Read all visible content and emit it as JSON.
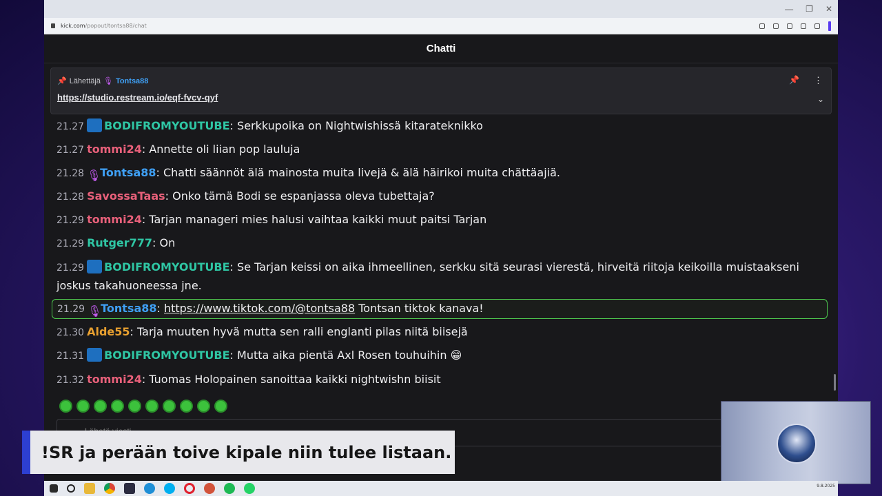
{
  "browser": {
    "url_prefix": "kick.com",
    "url_path": "/popout/tontsa88/chat"
  },
  "chat": {
    "title": "Chatti",
    "pinned": {
      "sender_label": "Lähettäjä",
      "sender_name": "Tontsa88",
      "link": "https://studio.restream.io/eqf-fvcv-qyf"
    },
    "messages": [
      {
        "time": "21.27",
        "user": "BODIFROMYOUTUBE",
        "user_color": "#2fc6a4",
        "badge": "mod",
        "text": "Serkkupoika on Nightwishissä kitarateknikko"
      },
      {
        "time": "21.27",
        "user": "tommi24",
        "user_color": "#e8607a",
        "badge": "",
        "text": "Annette oli liian pop lauluja"
      },
      {
        "time": "21.28",
        "user": "Tontsa88",
        "user_color": "#3fa0f5",
        "badge": "mic",
        "text": "Chatti säännöt älä mainosta muita livejä & älä häirikoi muita chättäajiä."
      },
      {
        "time": "21.28",
        "user": "SavossaTaas",
        "user_color": "#e8607a",
        "badge": "",
        "text": "Onko tämä Bodi se espanjassa oleva tubettaja?"
      },
      {
        "time": "21.29",
        "user": "tommi24",
        "user_color": "#e8607a",
        "badge": "",
        "text": "Tarjan manageri mies halusi vaihtaa kaikki muut paitsi Tarjan"
      },
      {
        "time": "21.29",
        "user": "Rutger777",
        "user_color": "#2fc6a4",
        "badge": "",
        "text": "On"
      },
      {
        "time": "21.29",
        "user": "BODIFROMYOUTUBE",
        "user_color": "#2fc6a4",
        "badge": "mod",
        "text": "Se Tarjan keissi on aika ihmeellinen, serkku sitä seurasi vierestä, hirveitä riitoja keikoilla muistaakseni joskus takahuoneessa jne."
      },
      {
        "time": "21.29",
        "user": "Tontsa88",
        "user_color": "#3fa0f5",
        "badge": "mic",
        "link": "https://www.tiktok.com/@tontsa88",
        "text": "Tontsan tiktok kanava!"
      },
      {
        "time": "21.30",
        "user": "Alde55",
        "user_color": "#e8a030",
        "badge": "",
        "text": "Tarja muuten hyvä mutta sen ralli englanti pilas niitä biisejä"
      },
      {
        "time": "21.31",
        "user": "BODIFROMYOUTUBE",
        "user_color": "#2fc6a4",
        "badge": "mod",
        "text": "Mutta aika pientä Axl Rosen touhuihin 😁"
      },
      {
        "time": "21.32",
        "user": "tommi24",
        "user_color": "#e8607a",
        "badge": "",
        "text": "Tuomas Holopainen sanoittaa kaikki nightwishn biisit"
      }
    ],
    "input_placeholder": "Lähetä viesti"
  },
  "overlay": {
    "banner_text": "!SR ja perään toive kipale niin tulee listaan."
  },
  "taskbar": {
    "clock_date": "9.8.2025"
  },
  "colors": {
    "accent_green": "#4ec94e",
    "mod_badge": "#1e6fbf",
    "banner_accent": "#2d3fd1"
  }
}
